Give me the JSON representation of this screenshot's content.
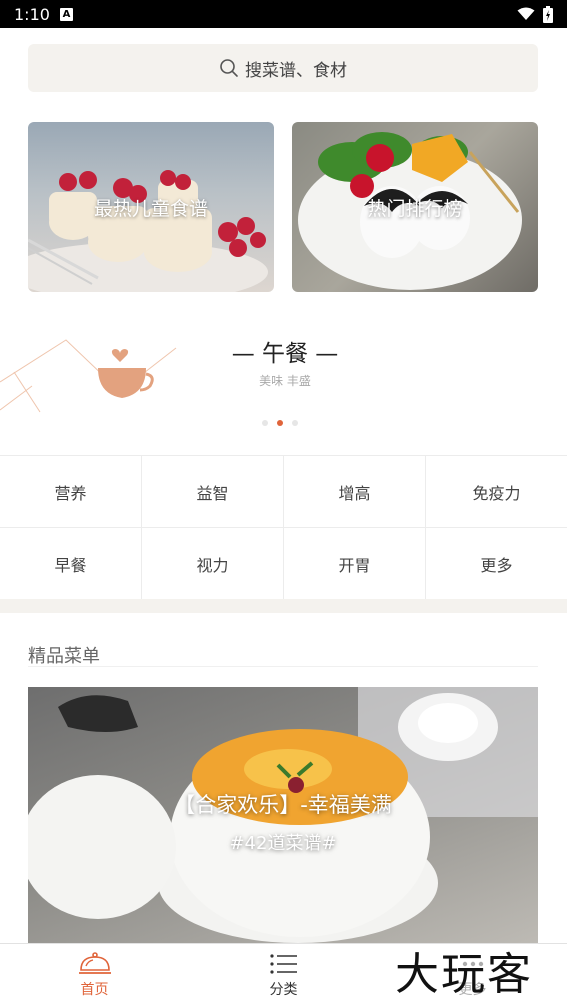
{
  "status_bar": {
    "time": "1:10",
    "notification_badge": "A"
  },
  "search": {
    "placeholder": "搜菜谱、食材"
  },
  "banners": [
    {
      "label": "最热儿童食谱"
    },
    {
      "label": "热门排行榜"
    }
  ],
  "meal_carousel": {
    "title": "— 午餐 —",
    "subtitle": "美味 丰盛",
    "page_count": 3,
    "active_page": 2
  },
  "categories": [
    [
      "营养",
      "益智",
      "增高",
      "免疫力"
    ],
    [
      "早餐",
      "视力",
      "开胃",
      "更多"
    ]
  ],
  "featured": {
    "section_title": "精品菜单",
    "title": "【合家欢乐】-幸福美满",
    "subtitle": "#42道菜谱#"
  },
  "bottom_nav": [
    {
      "label": "首页",
      "icon": "cloche-icon",
      "active": true
    },
    {
      "label": "分类",
      "icon": "list-icon",
      "active": false
    },
    {
      "label": "更多",
      "icon": "more-icon",
      "active": false
    }
  ],
  "watermark": "大玩客",
  "colors": {
    "accent": "#e0643a",
    "search_bg": "#f4f2ee",
    "cup": "#e3a27f"
  }
}
